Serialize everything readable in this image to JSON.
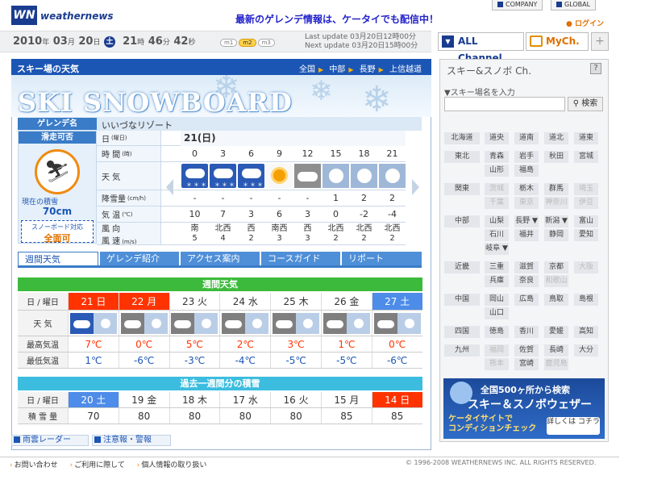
{
  "header": {
    "logo_mark": "WN",
    "logo_text": "weathernews",
    "promo": "最新のゲレンデ情報は、ケータイでも配信中！",
    "company": "COMPANY",
    "global": "GLOBAL",
    "login": "ログイン"
  },
  "datebar": {
    "year": "2010",
    "year_u": "年",
    "month": "03",
    "month_u": "月",
    "day": "20",
    "day_u": "日",
    "dow": "土",
    "hour": "21",
    "hour_u": "時",
    "min": "46",
    "min_u": "分",
    "sec": "42",
    "sec_u": "秒",
    "size_s": "m1",
    "size_m": "m2",
    "size_l": "m3",
    "last_update": "Last update  03月20日12時00分",
    "next_update": "Next update  03月20日15時00分"
  },
  "channel": {
    "all": "ALL Channel",
    "my": "MyCh.",
    "all_icon": "channel-icon",
    "plus": "+"
  },
  "main": {
    "title": "スキー場の天気",
    "crumbs": [
      "全国",
      "中部",
      "長野",
      "上信越道"
    ],
    "banner_text": "SKI SNOWBOARD",
    "resort_label": "ゲレンデ名",
    "resort_name": "いいづなリゾート",
    "status_label": "滑走可否",
    "snow_label": "現在の積雪",
    "snow_value": "70cm",
    "sb_label": "スノーボード対応",
    "sb_value": "全面可"
  },
  "forecast": {
    "day_label": "日",
    "day_sub": "(曜日)",
    "day_value": "21(日)",
    "time_label": "時 間",
    "time_sub": "(時)",
    "times": [
      "0",
      "3",
      "6",
      "9",
      "12",
      "15",
      "18",
      "21"
    ],
    "weather_label": "天 気",
    "weather_icons": [
      "snow-icon",
      "snow-icon",
      "snow-icon",
      "sunny-icon",
      "cloudy-icon",
      "snowflake-icon",
      "snowflake-icon",
      "snowflake-icon"
    ],
    "snowfall_label": "降雪量",
    "snowfall_sub": "(cm/h)",
    "snowfall": [
      "-",
      "-",
      "-",
      "-",
      "-",
      "1",
      "2",
      "2"
    ],
    "temp_label": "気 温",
    "temp_sub": "(℃)",
    "temps": [
      "10",
      "7",
      "3",
      "6",
      "3",
      "0",
      "-2",
      "-4"
    ],
    "wind_label1": "風 向",
    "wind_label2": "風 速",
    "wind_sub": "(m/s)",
    "wind_dir": [
      "南",
      "北西",
      "西",
      "南西",
      "西",
      "北西",
      "北西",
      "北西"
    ],
    "wind_speed": [
      "5",
      "4",
      "2",
      "3",
      "3",
      "2",
      "2",
      "2"
    ]
  },
  "tabs": [
    "週間天気",
    "ゲレンデ紹介",
    "アクセス案内",
    "コースガイド",
    "リポート"
  ],
  "weekly": {
    "title": "週間天気",
    "day_label": "日 / 曜日",
    "days": [
      "21 日",
      "22 月",
      "23 火",
      "24 水",
      "25 木",
      "26 金",
      "27 土"
    ],
    "weather_label": "天 気",
    "hi_label": "最高気温",
    "hi": [
      "7℃",
      "0℃",
      "5℃",
      "2℃",
      "3℃",
      "1℃",
      "0℃"
    ],
    "lo_label": "最低気温",
    "lo": [
      "1℃",
      "-6℃",
      "-3℃",
      "-4℃",
      "-5℃",
      "-5℃",
      "-6℃"
    ]
  },
  "past": {
    "title": "過去一週間分の積雪",
    "day_label": "日 / 曜日",
    "days": [
      "20 土",
      "19 金",
      "18 木",
      "17 水",
      "16 火",
      "15 月",
      "14 日"
    ],
    "snow_label": "積 雪 量",
    "snow": [
      "70",
      "80",
      "80",
      "80",
      "80",
      "85",
      "85"
    ]
  },
  "bottom_buttons": [
    "雨雲レーダー",
    "注意報・警報"
  ],
  "right": {
    "title": "スキー&スノボ Ch.",
    "help": "?",
    "search_label": "▼スキー場名を入力",
    "search_placeholder": "",
    "search_btn": "検索",
    "regions": [
      {
        "name": "北海道",
        "prefs": [
          "道央",
          "道南",
          "道北",
          "道東"
        ]
      },
      {
        "name": "東北",
        "prefs": [
          "青森",
          "岩手",
          "秋田",
          "宮城",
          "山形",
          "福島"
        ]
      },
      {
        "name": "関東",
        "prefs": [
          "茨城",
          "栃木",
          "群馬",
          "埼玉",
          "千葉",
          "東京",
          "神奈川",
          "伊豆"
        ]
      },
      {
        "name": "中部",
        "prefs": [
          "山梨",
          "長野 ▼",
          "新潟 ▼",
          "富山",
          "石川",
          "福井",
          "静岡",
          "愛知",
          "岐阜 ▼"
        ]
      },
      {
        "name": "近畿",
        "prefs": [
          "三重",
          "滋賀",
          "京都",
          "大阪",
          "兵庫",
          "奈良",
          "和歌山"
        ]
      },
      {
        "name": "中国",
        "prefs": [
          "岡山",
          "広島",
          "鳥取",
          "島根",
          "山口"
        ]
      },
      {
        "name": "四国",
        "prefs": [
          "徳島",
          "香川",
          "愛媛",
          "高知"
        ]
      },
      {
        "name": "九州",
        "prefs": [
          "福岡",
          "佐賀",
          "長崎",
          "大分",
          "熊本",
          "宮崎",
          "鹿児島"
        ]
      }
    ],
    "ad_line1": "全国500ヶ所から検索",
    "ad_line2": "スキー＆スノボウェザー",
    "ad_line3": "ケータイサイトで",
    "ad_line4": "コンディションチェック",
    "ad_btn": "詳しくは コチラ"
  },
  "footer": {
    "links": [
      "お問い合わせ",
      "ご利用に際して",
      "個人情報の取り扱い"
    ],
    "copyright": "© 1996-2008 WEATHERNEWS INC. ALL RIGHTS RESERVED."
  }
}
